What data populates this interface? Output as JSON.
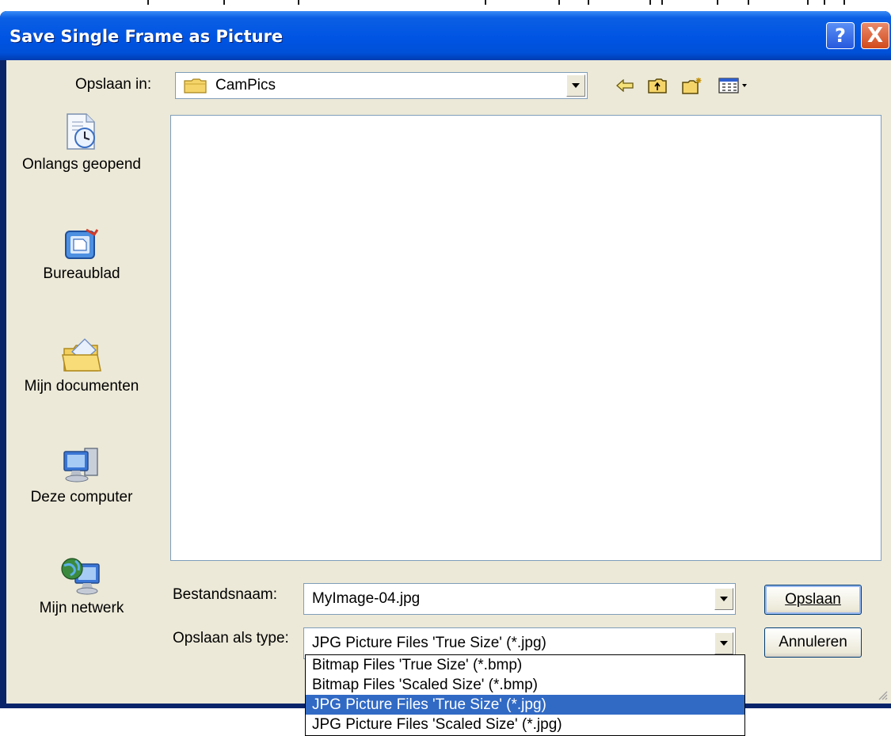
{
  "window": {
    "title": "Save Single Frame as Picture",
    "help_button": "?",
    "close_button": "X"
  },
  "toolbar": {
    "lookin_label": "Opslaan in:",
    "lookin_value": "CamPics",
    "icons": [
      "back-arrow-icon",
      "up-folder-icon",
      "new-folder-icon",
      "view-menu-icon"
    ]
  },
  "places": [
    {
      "label": "Onlangs geopend",
      "icon": "recent-documents-icon"
    },
    {
      "label": "Bureaublad",
      "icon": "desktop-icon"
    },
    {
      "label": "Mijn documenten",
      "icon": "my-documents-icon"
    },
    {
      "label": "Deze computer",
      "icon": "my-computer-icon"
    },
    {
      "label": "Mijn netwerk",
      "icon": "my-network-icon"
    }
  ],
  "filename": {
    "label": "Bestandsnaam:",
    "value": "MyImage-04.jpg"
  },
  "filetype": {
    "label": "Opslaan als type:",
    "value": "JPG Picture Files 'True Size' (*.jpg)",
    "options": [
      "Bitmap Files 'True Size' (*.bmp)",
      "Bitmap Files 'Scaled Size' (*.bmp)",
      "JPG Picture Files 'True Size' (*.jpg)",
      "JPG Picture Files 'Scaled Size' (*.jpg)"
    ],
    "selected_index": 2
  },
  "buttons": {
    "save": "Opslaan",
    "cancel": "Annuleren"
  },
  "colors": {
    "titlebar": "#0054e3",
    "dialog_face": "#ece9d8",
    "selection": "#316ac5",
    "close_button": "#d24a1c"
  }
}
